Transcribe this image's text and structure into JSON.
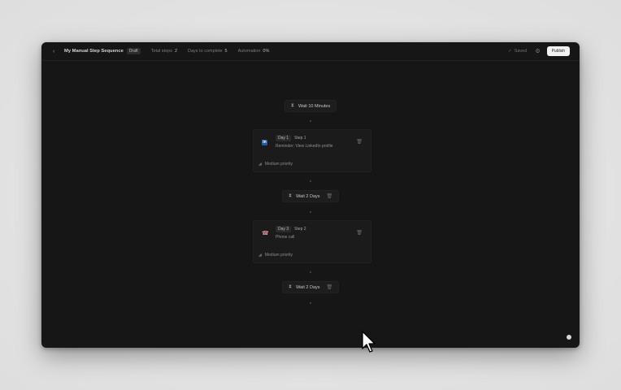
{
  "header": {
    "back_icon": "chevron-left-icon",
    "title": "My Manual Step Sequence",
    "status_badge": "Draft",
    "total_steps_label": "Total steps",
    "total_steps_value": "2",
    "days_label": "Days to complete",
    "days_value": "5",
    "automation_label": "Automation",
    "automation_value": "0%",
    "saved_label": "Saved",
    "publish_label": "Publish"
  },
  "flow": {
    "wait1": "Wait 10 Minutes",
    "step1": {
      "day": "Day 1",
      "step": "Step 1",
      "description": "Reminder: View LinkedIn profile",
      "priority": "Medium priority",
      "icon": "linkedin-icon"
    },
    "wait2": "Wait 2 Days",
    "step2": {
      "day": "Day 3",
      "step": "Step 2",
      "description": "Phone call",
      "priority": "Medium priority",
      "icon": "phone-icon"
    },
    "wait3": "Wait 2 Days"
  },
  "colors": {
    "canvas": "#161616",
    "publish_button": "#f2f2f2",
    "linkedin": "#1e5ea8",
    "phone": "#d78b95"
  }
}
